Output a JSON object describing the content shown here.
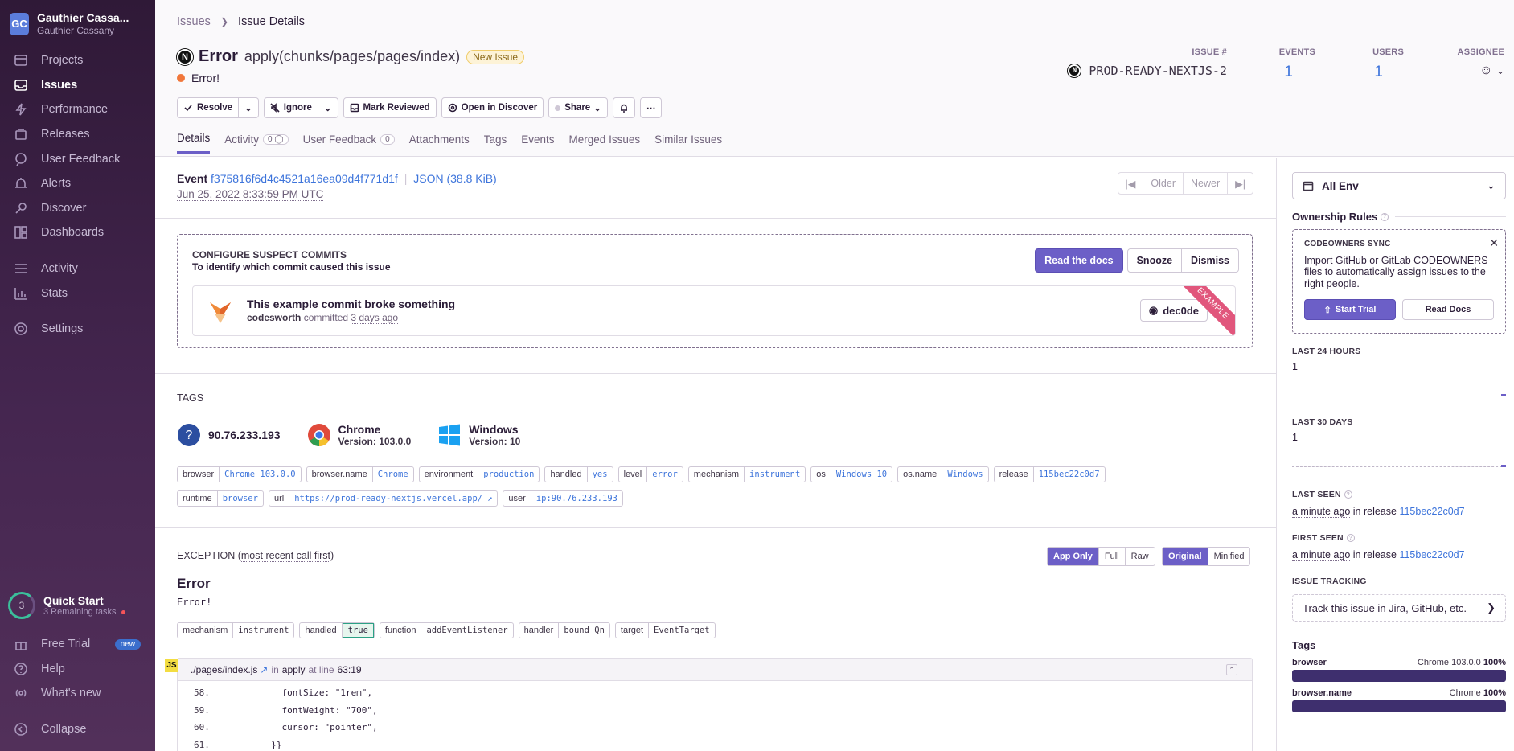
{
  "org": {
    "initials": "GC",
    "name": "Gauthier Cassa...",
    "user": "Gauthier Cassany"
  },
  "nav": {
    "primary": [
      {
        "label": "Projects",
        "icon": "projects-icon"
      },
      {
        "label": "Issues",
        "icon": "issues-icon"
      },
      {
        "label": "Performance",
        "icon": "performance-icon"
      },
      {
        "label": "Releases",
        "icon": "releases-icon"
      },
      {
        "label": "User Feedback",
        "icon": "feedback-icon"
      },
      {
        "label": "Alerts",
        "icon": "alerts-icon"
      },
      {
        "label": "Discover",
        "icon": "discover-icon"
      },
      {
        "label": "Dashboards",
        "icon": "dashboards-icon"
      }
    ],
    "secondary": [
      {
        "label": "Activity",
        "icon": "activity-icon"
      },
      {
        "label": "Stats",
        "icon": "stats-icon"
      }
    ],
    "settings": "Settings",
    "quickstart": {
      "count": "3",
      "title": "Quick Start",
      "sub": "3 Remaining tasks"
    },
    "free_trial": "Free Trial",
    "new_badge": "new",
    "help": "Help",
    "whats_new": "What's new",
    "collapse": "Collapse"
  },
  "breadcrumb": {
    "parent": "Issues",
    "current": "Issue Details"
  },
  "issue": {
    "platform_glyph": "N",
    "type": "Error",
    "culprit": "apply(chunks/pages/pages/index)",
    "badge": "New Issue",
    "message": "Error!",
    "id_label": "ISSUE #",
    "id": "PROD-READY-NEXTJS-2",
    "events_label": "EVENTS",
    "events": "1",
    "users_label": "USERS",
    "users": "1",
    "assignee_label": "ASSIGNEE"
  },
  "actions": {
    "resolve": "Resolve",
    "ignore": "Ignore",
    "mark_reviewed": "Mark Reviewed",
    "open_discover": "Open in Discover",
    "share": "Share"
  },
  "tabs": [
    {
      "label": "Details"
    },
    {
      "label": "Activity",
      "count": "0"
    },
    {
      "label": "User Feedback",
      "count": "0"
    },
    {
      "label": "Attachments"
    },
    {
      "label": "Tags"
    },
    {
      "label": "Events"
    },
    {
      "label": "Merged Issues"
    },
    {
      "label": "Similar Issues"
    }
  ],
  "event": {
    "label": "Event",
    "id": "f375816f6d4c4521a16ea09d4f771d1f",
    "json": "JSON (38.8 KiB)",
    "date": "Jun 25, 2022 8:33:59 PM UTC",
    "older": "Older",
    "newer": "Newer"
  },
  "suspect": {
    "title": "CONFIGURE SUSPECT COMMITS",
    "subtitle": "To identify which commit caused this issue",
    "read_docs": "Read the docs",
    "snooze": "Snooze",
    "dismiss": "Dismiss",
    "commit_title": "This example commit broke something",
    "author": "codesworth",
    "committed": "committed",
    "when": "3 days ago",
    "sha": "dec0de",
    "ribbon": "EXAMPLE"
  },
  "tags_section": {
    "title": "TAGS",
    "ip": "90.76.233.193",
    "browser_name": "Chrome",
    "browser_version_label": "Version:",
    "browser_version": "103.0.0",
    "os_name": "Windows",
    "os_version_label": "Version:",
    "os_version": "10",
    "row1": [
      {
        "k": "browser",
        "v": "Chrome 103.0.0"
      },
      {
        "k": "browser.name",
        "v": "Chrome"
      },
      {
        "k": "environment",
        "v": "production"
      },
      {
        "k": "handled",
        "v": "yes"
      },
      {
        "k": "level",
        "v": "error"
      },
      {
        "k": "mechanism",
        "v": "instrument"
      },
      {
        "k": "os",
        "v": "Windows 10"
      },
      {
        "k": "os.name",
        "v": "Windows"
      },
      {
        "k": "release",
        "v": "115bec22c0d7"
      }
    ],
    "row2": [
      {
        "k": "runtime",
        "v": "browser"
      },
      {
        "k": "url",
        "v": "https://prod-ready-nextjs.vercel.app/"
      },
      {
        "k": "user",
        "v": "ip:90.76.233.193"
      }
    ]
  },
  "exception": {
    "title": "EXCEPTION",
    "hint": "most recent call first",
    "app_only": "App Only",
    "full": "Full",
    "raw": "Raw",
    "original": "Original",
    "minified": "Minified",
    "type": "Error",
    "value": "Error!",
    "mechanism": [
      {
        "k": "mechanism",
        "v": "instrument"
      },
      {
        "k": "handled",
        "v": "true"
      },
      {
        "k": "function",
        "v": "addEventListener"
      },
      {
        "k": "handler",
        "v": "bound Qn"
      },
      {
        "k": "target",
        "v": "EventTarget"
      }
    ],
    "frame": {
      "badge": "JS",
      "file": "./pages/index.js",
      "in": "in",
      "fn": "apply",
      "at": "at line",
      "line": "63:19"
    },
    "code": [
      {
        "n": "58.",
        "t": "            fontSize: \"1rem\","
      },
      {
        "n": "59.",
        "t": "            fontWeight: \"700\","
      },
      {
        "n": "60.",
        "t": "            cursor: \"pointer\","
      },
      {
        "n": "61.",
        "t": "          }}"
      }
    ]
  },
  "sidebar": {
    "env": "All Env",
    "ownership": "Ownership Rules",
    "co_title": "CODEOWNERS SYNC",
    "co_text": "Import GitHub or GitLab CODEOWNERS files to automatically assign issues to the right people.",
    "start_trial": "Start Trial",
    "read_docs": "Read Docs",
    "last24_label": "LAST 24 HOURS",
    "last24": "1",
    "last30_label": "LAST 30 DAYS",
    "last30": "1",
    "last_seen_label": "LAST SEEN",
    "last_seen": "a minute ago",
    "in_release": "in release",
    "release": "115bec22c0d7",
    "first_seen_label": "FIRST SEEN",
    "first_seen": "a minute ago",
    "tracking_label": "ISSUE TRACKING",
    "tracking": "Track this issue in Jira, GitHub, etc.",
    "tags_title": "Tags",
    "tag_bars": [
      {
        "k": "browser",
        "v": "Chrome 103.0.0",
        "pct": "100%"
      },
      {
        "k": "browser.name",
        "v": "Chrome",
        "pct": "100%"
      }
    ]
  },
  "colors": {
    "accent": "#6c5fc7",
    "link": "#3d74db",
    "sidebar": "#2f1937",
    "error_dot": "#f1773b"
  }
}
